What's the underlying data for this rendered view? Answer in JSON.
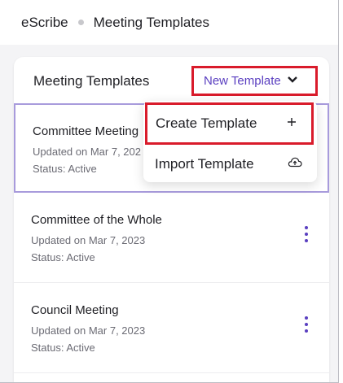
{
  "breadcrumb": {
    "root": "eScribe",
    "current": "Meeting Templates"
  },
  "panel": {
    "title": "Meeting Templates",
    "new_template_label": "New Template"
  },
  "templates": [
    {
      "name": "Committee Meeting",
      "updated": "Updated on Mar 7, 202",
      "status": "Status: Active"
    },
    {
      "name": "Committee of the Whole",
      "updated": "Updated on Mar 7, 2023",
      "status": "Status: Active"
    },
    {
      "name": "Council Meeting",
      "updated": "Updated on Mar 7, 2023",
      "status": "Status: Active"
    }
  ],
  "menu": {
    "create_label": "Create Template",
    "import_label": "Import Template",
    "create_icon": "plus-icon",
    "import_icon": "cloud-upload-icon"
  },
  "colors": {
    "accent": "#5a3fc0",
    "highlight": "#d91b2b",
    "selected_border": "#a89bdc"
  }
}
